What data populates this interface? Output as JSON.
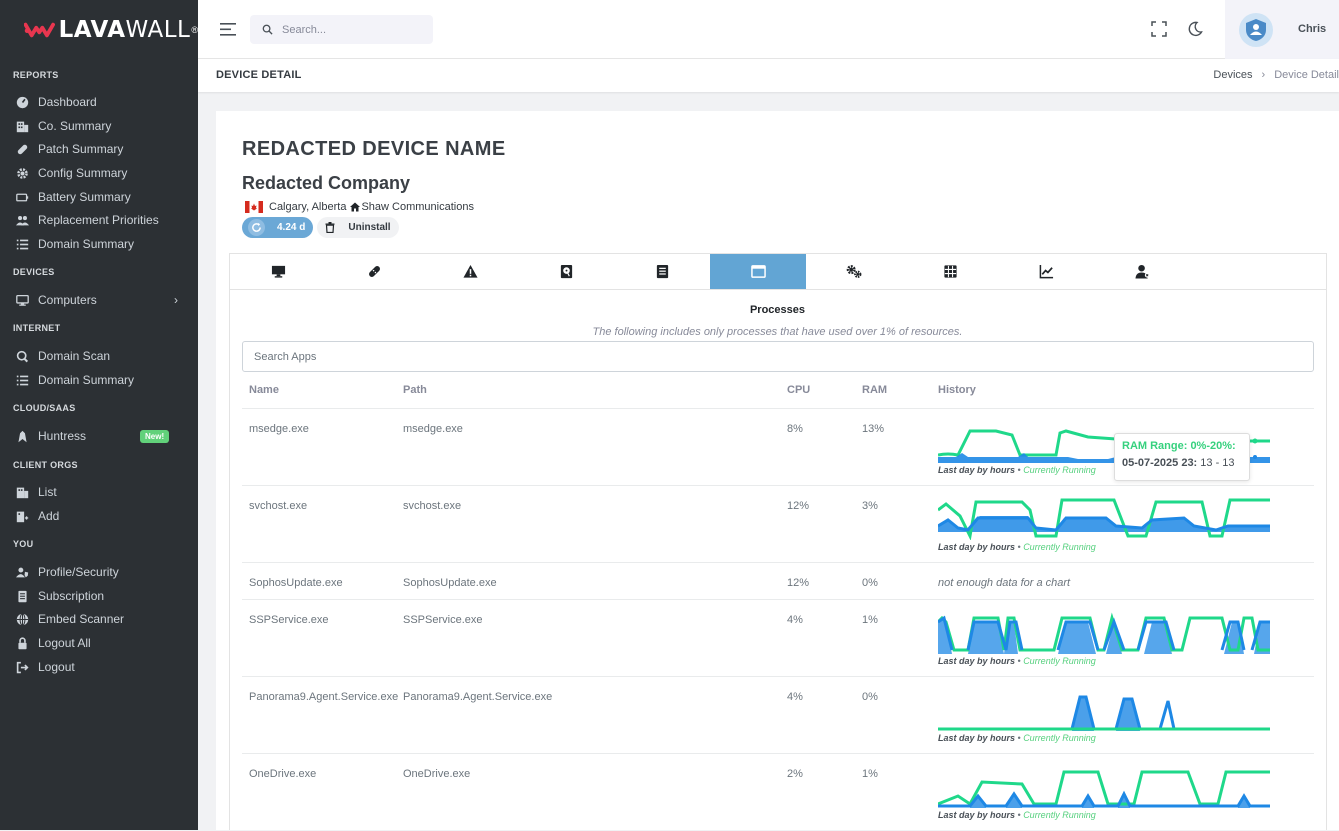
{
  "brand": {
    "name_bold": "LAVA",
    "name_light": "WALL",
    "reg": "®"
  },
  "sidebar": {
    "sections": [
      {
        "title": "REPORTS",
        "items": [
          "Dashboard",
          "Co. Summary",
          "Patch Summary",
          "Config Summary",
          "Battery Summary",
          "Replacement Priorities",
          "Domain Summary"
        ]
      },
      {
        "title": "DEVICES",
        "items": [
          "Computers"
        ]
      },
      {
        "title": "INTERNET",
        "items": [
          "Domain Scan",
          "Domain Summary"
        ]
      },
      {
        "title": "CLOUD/SAAS",
        "items": [
          "Huntress"
        ]
      },
      {
        "title": "CLIENT ORGS",
        "items": [
          "List",
          "Add"
        ]
      },
      {
        "title": "YOU",
        "items": [
          "Profile/Security",
          "Subscription",
          "Embed Scanner",
          "Logout All",
          "Logout"
        ]
      }
    ],
    "new_badge": "New!",
    "computers_chevron": "›"
  },
  "topbar": {
    "search_placeholder": "Search...",
    "user_name": "Chris"
  },
  "pagebar": {
    "title": "DEVICE DETAIL",
    "crumb_1": "Devices",
    "crumb_sep": "›",
    "crumb_2": "Device Detail"
  },
  "device": {
    "name": "REDACTED DEVICE NAME",
    "company": "Redacted Company",
    "location": "Calgary, Alberta",
    "isp": "Shaw Communications",
    "uptime": "4.24 d",
    "uninstall_label": "Uninstall"
  },
  "tabs": [
    {
      "icon": "monitor-icon",
      "active": false
    },
    {
      "icon": "bandage-icon",
      "active": false
    },
    {
      "icon": "warning-icon",
      "active": false
    },
    {
      "icon": "hard-drive-icon",
      "active": false
    },
    {
      "icon": "document-icon",
      "active": false
    },
    {
      "icon": "window-icon",
      "active": true
    },
    {
      "icon": "gears-icon",
      "active": false
    },
    {
      "icon": "grid-icon",
      "active": false
    },
    {
      "icon": "line-chart-icon",
      "active": false
    },
    {
      "icon": "user-tie-icon",
      "active": false
    }
  ],
  "processes": {
    "title": "Processes",
    "subtitle": "The following includes only processes that have used over 1% of resources.",
    "search_placeholder": "Search Apps",
    "columns": {
      "name": "Name",
      "path": "Path",
      "cpu": "CPU",
      "ram": "RAM",
      "history": "History"
    },
    "caption_bold": "Last day by hours",
    "caption_sep": " • ",
    "caption_status": "Currently Running",
    "no_data": "not enough data for a chart",
    "rows": [
      {
        "name": "msedge.exe",
        "path": "msedge.exe",
        "cpu": "8%",
        "ram": "13%",
        "has_chart": true
      },
      {
        "name": "svchost.exe",
        "path": "svchost.exe",
        "cpu": "12%",
        "ram": "3%",
        "has_chart": true
      },
      {
        "name": "SophosUpdate.exe",
        "path": "SophosUpdate.exe",
        "cpu": "12%",
        "ram": "0%",
        "has_chart": false
      },
      {
        "name": "SSPService.exe",
        "path": "SSPService.exe",
        "cpu": "4%",
        "ram": "1%",
        "has_chart": true
      },
      {
        "name": "Panorama9.Agent.Service.exe",
        "path": "Panorama9.Agent.Service.exe",
        "cpu": "4%",
        "ram": "0%",
        "has_chart": true
      },
      {
        "name": "OneDrive.exe",
        "path": "OneDrive.exe",
        "cpu": "2%",
        "ram": "1%",
        "has_chart": true
      }
    ],
    "tooltip": {
      "title": "RAM Range: 0%-20%:",
      "date": "05-07-2025 23:",
      "value": " 13 - 13"
    }
  },
  "colors": {
    "sidebar_bg": "#2c3034",
    "accent_blue": "#62a5d4",
    "ram_green": "#1fd88a",
    "cpu_blue": "#1e88e5",
    "badge_green": "#61d17a"
  }
}
